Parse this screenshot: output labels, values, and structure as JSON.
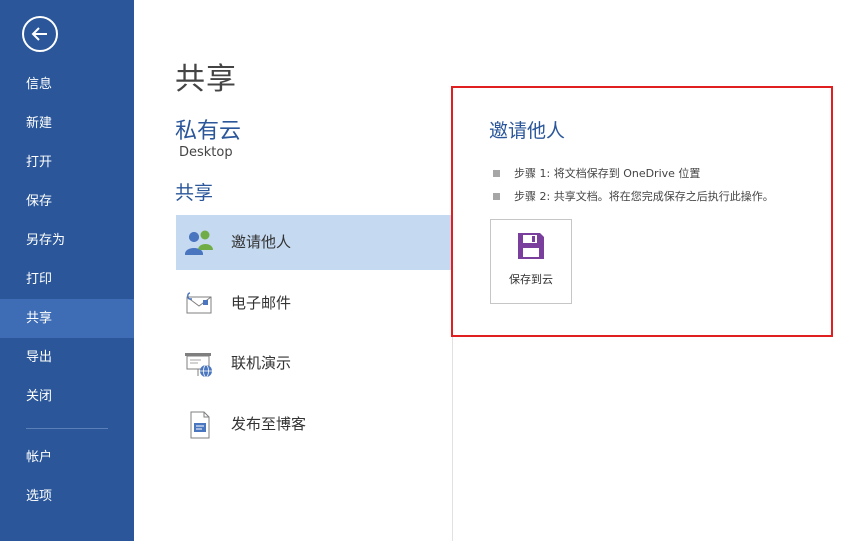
{
  "sidebar": {
    "items": [
      {
        "id": "info",
        "label": "信息"
      },
      {
        "id": "new",
        "label": "新建"
      },
      {
        "id": "open",
        "label": "打开"
      },
      {
        "id": "save",
        "label": "保存"
      },
      {
        "id": "saveas",
        "label": "另存为"
      },
      {
        "id": "print",
        "label": "打印"
      },
      {
        "id": "share",
        "label": "共享",
        "active": true
      },
      {
        "id": "export",
        "label": "导出"
      },
      {
        "id": "close",
        "label": "关闭"
      },
      {
        "id": "account",
        "label": "帐户"
      },
      {
        "id": "options",
        "label": "选项"
      }
    ],
    "colors": {
      "background": "#2b579a",
      "active": "#3e6db5"
    }
  },
  "main": {
    "title": "共享",
    "location": {
      "name": "私有云",
      "sub": "Desktop"
    },
    "share_heading": "共享",
    "options": [
      {
        "label": "邀请他人",
        "icon": "invite-people-icon",
        "selected": true
      },
      {
        "label": "电子邮件",
        "icon": "email-icon"
      },
      {
        "label": "联机演示",
        "icon": "present-online-icon"
      },
      {
        "label": "发布至博客",
        "icon": "blog-post-icon"
      }
    ]
  },
  "panel": {
    "title": "邀请他人",
    "steps": [
      "步骤 1: 将文档保存到 OneDrive 位置",
      "步骤 2: 共享文档。将在您完成保存之后执行此操作。"
    ],
    "button_label": "保存到云",
    "button_icon": "save-floppy-icon",
    "highlight_color": "#e02020"
  }
}
